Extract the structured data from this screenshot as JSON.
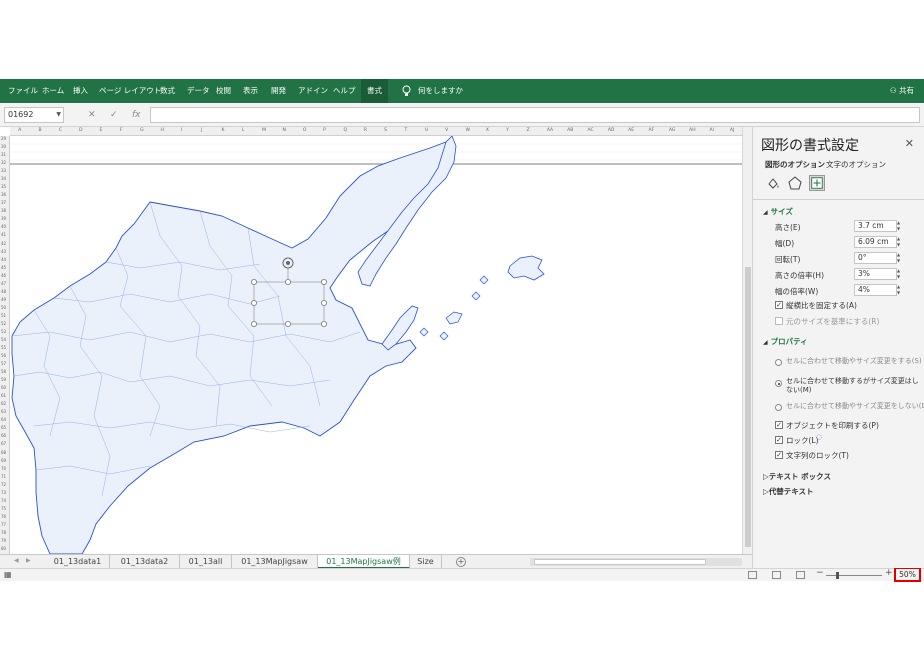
{
  "ribbon": {
    "tabs": [
      "ファイル",
      "ホーム",
      "挿入",
      "ページ レイアウト",
      "数式",
      "データ",
      "校閲",
      "表示",
      "開発",
      "アドイン",
      "ヘルプ",
      "書式"
    ],
    "active_tab": "書式",
    "tell_me": "何をしますか",
    "share": "共有"
  },
  "formula_bar": {
    "name_box": "01692",
    "cancel": "✕",
    "enter": "✓",
    "fx": "fx",
    "content": ""
  },
  "grid": {
    "columns": [
      "A",
      "B",
      "C",
      "D",
      "E",
      "F",
      "G",
      "H",
      "I",
      "J",
      "K",
      "L",
      "M",
      "N",
      "O",
      "P",
      "Q",
      "R",
      "S",
      "T",
      "U",
      "V",
      "W",
      "X",
      "Y",
      "Z",
      "AA",
      "AB",
      "AC",
      "AD",
      "AE",
      "AF",
      "AG",
      "AH",
      "AI",
      "AJ"
    ],
    "row_start": 29,
    "row_end": 80
  },
  "sheets": {
    "tabs": [
      "01_13data1",
      "01_13data2",
      "01_13all",
      "01_13MapJigsaw",
      "01_13MapJigsaw例",
      "Size"
    ],
    "active": "01_13MapJigsaw例",
    "add": "+"
  },
  "status": {
    "zoom": "50%",
    "zoom_minus": "−",
    "zoom_plus": "+"
  },
  "pane": {
    "title": "図形の書式設定",
    "close": "✕",
    "tab_shape": "図形のオプション",
    "tab_text": "文字のオプション",
    "size": {
      "header": "サイズ",
      "height_label": "高さ(E)",
      "height_value": "3.7 cm",
      "width_label": "幅(D)",
      "width_value": "6.09 cm",
      "rotation_label": "回転(T)",
      "rotation_value": "0°",
      "scale_h_label": "高さの倍率(H)",
      "scale_h_value": "3%",
      "scale_w_label": "幅の倍率(W)",
      "scale_w_value": "4%",
      "lock_aspect": "縦横比を固定する(A)",
      "relative_original": "元のサイズを基準にする(R)"
    },
    "properties": {
      "header": "プロパティ",
      "radio1": "セルに合わせて移動やサイズ変更をする(S)",
      "radio2_line1": "セルに合わせて移動するがサイズ変更はし",
      "radio2_line2": "ない(M)",
      "radio3": "セルに合わせて移動やサイズ変更をしない(D)",
      "print_object": "オブジェクトを印刷する(P)",
      "locked": "ロック(L)",
      "lock_text": "文字列のロック(T)"
    },
    "textbox": "テキスト ボックス",
    "alt_text": "代替テキスト"
  }
}
